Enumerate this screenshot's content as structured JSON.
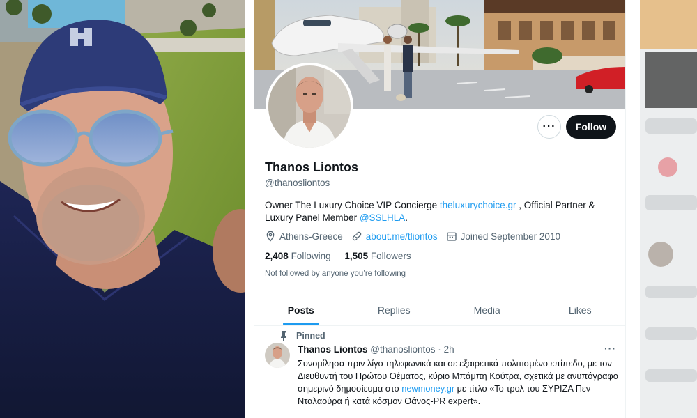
{
  "profile": {
    "display_name": "Thanos Liontos",
    "handle": "@thanosliontos",
    "follow_label": "Follow",
    "more_label": "···",
    "bio": {
      "part1": "Owner The Luxury Choice VIP Concierge ",
      "link1": "theluxurychoice.gr",
      "part2": " , Official Partner & Luxury Panel Member ",
      "link2": "@SSLHLA",
      "part3": "."
    },
    "location": "Athens-Greece",
    "website": "about.me/tliontos",
    "joined": "Joined September 2010",
    "following_count": "2,408",
    "following_label": "Following",
    "followers_count": "1,505",
    "followers_label": "Followers",
    "not_followed": "Not followed by anyone you’re following"
  },
  "tabs": [
    {
      "label": "Posts",
      "active": true
    },
    {
      "label": "Replies",
      "active": false
    },
    {
      "label": "Media",
      "active": false
    },
    {
      "label": "Likes",
      "active": false
    }
  ],
  "post": {
    "pinned_label": "Pinned",
    "author_name": "Thanos Liontos",
    "author_handle": "@thanosliontos",
    "separator": "·",
    "time": "2h",
    "more_label": "···",
    "text_part1": "Συνομίλησα πριν λίγο τηλεφωνικά και σε εξαιρετικά πολιτισμένο επίπεδο, με τον Διευθυντή του Πρώτου Θέματος, κύριο Μπάμπη Κούτρα, σχετικά με ανυπόγραφο σημερινό δημοσίευμα στο ",
    "text_link": "newmoney.gr",
    "text_part2": " με τίτλο «Το τρολ του ΣΥΡΙΖΑ Πεν Νταλαούρα ή κατά κόσμον Θάνος-PR expert»."
  },
  "icons": {
    "location": "location-pin-icon",
    "link": "link-icon",
    "calendar": "calendar-icon",
    "pin": "pin-icon",
    "more": "more-dots-icon"
  },
  "colors": {
    "accent": "#1d9bf0",
    "text_primary": "#0f1419",
    "text_secondary": "#536471",
    "follow_button_bg": "#0f1419"
  }
}
